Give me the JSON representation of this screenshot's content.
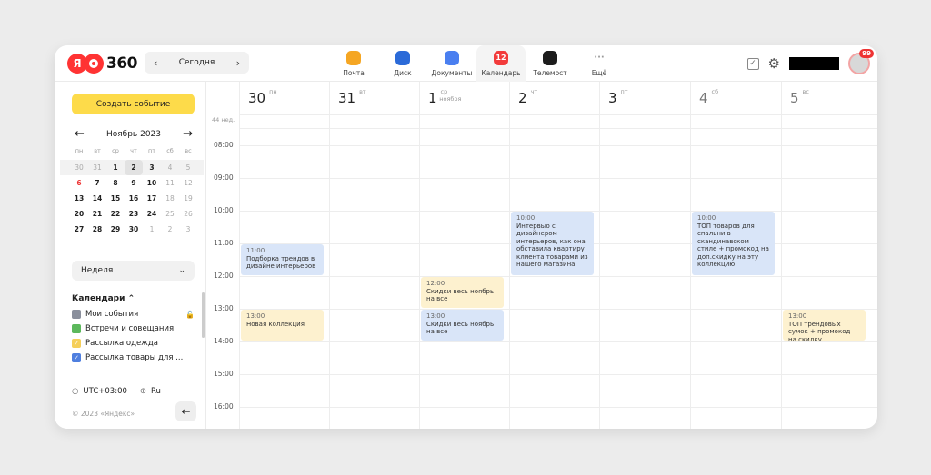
{
  "header": {
    "logo_ya": "Я",
    "logo_num": "360",
    "today_label": "Сегодня",
    "prev_icon": "chevron-left-icon",
    "next_icon": "chevron-right-icon"
  },
  "apps": [
    {
      "label": "Почта",
      "color": "#f5a623",
      "icon": "mail-icon"
    },
    {
      "label": "Диск",
      "color": "#2b6ad8",
      "icon": "disk-icon"
    },
    {
      "label": "Документы",
      "color": "#4a7ff0",
      "icon": "documents-icon"
    },
    {
      "label": "Календарь",
      "color": "#f23b3b",
      "icon": "calendar-icon",
      "glyph": "12"
    },
    {
      "label": "Телемост",
      "color": "#1c1c1c",
      "icon": "telemost-icon"
    },
    {
      "label": "Ещё",
      "color": "",
      "icon": "more-icon",
      "glyph": "···"
    }
  ],
  "user": {
    "notification_count": "99"
  },
  "sidebar": {
    "create_label": "Создать событие",
    "month_label": "Ноябрь 2023",
    "dow": [
      "пн",
      "вт",
      "ср",
      "чт",
      "пт",
      "сб",
      "вс"
    ],
    "weeks": [
      [
        "30",
        "31",
        "1",
        "2",
        "3",
        "4",
        "5"
      ],
      [
        "6",
        "7",
        "8",
        "9",
        "10",
        "11",
        "12"
      ],
      [
        "13",
        "14",
        "15",
        "16",
        "17",
        "18",
        "19"
      ],
      [
        "20",
        "21",
        "22",
        "23",
        "24",
        "25",
        "26"
      ],
      [
        "27",
        "28",
        "29",
        "30",
        "1",
        "2",
        "3"
      ]
    ],
    "view_label": "Неделя",
    "calendars_label": "Календари",
    "calendars": [
      {
        "label": "Мои события",
        "color": "#8a8f9c",
        "checked": false
      },
      {
        "label": "Встречи и совещания",
        "color": "#5cb85c",
        "checked": false
      },
      {
        "label": "Рассылка одежда",
        "color": "#f5cf5a",
        "checked": true
      },
      {
        "label": "Рассылка товары для ...",
        "color": "#4f7fdf",
        "checked": true
      }
    ],
    "timezone": "UTC+03:00",
    "language": "Ru",
    "copyright": "© 2023 «Яндекс»"
  },
  "week": {
    "week_label": "44 нед.",
    "days": [
      {
        "num": "30",
        "dow": "пн",
        "extra": ""
      },
      {
        "num": "31",
        "dow": "вт",
        "extra": ""
      },
      {
        "num": "1",
        "dow": "ср",
        "extra": "ноября"
      },
      {
        "num": "2",
        "dow": "чт",
        "extra": ""
      },
      {
        "num": "3",
        "dow": "пт",
        "extra": ""
      },
      {
        "num": "4",
        "dow": "сб",
        "extra": ""
      },
      {
        "num": "5",
        "dow": "вс",
        "extra": ""
      }
    ],
    "hours": [
      "08:00",
      "09:00",
      "10:00",
      "11:00",
      "12:00",
      "13:00",
      "14:00",
      "15:00",
      "16:00"
    ]
  },
  "events": [
    {
      "day": 0,
      "start": "11:00",
      "end": "12:00",
      "time": "11:00",
      "title": "Подборка трендов в дизайне интерьеров",
      "color": "blue"
    },
    {
      "day": 0,
      "start": "13:00",
      "end": "14:00",
      "time": "13:00",
      "title": "Новая коллекция",
      "color": "yellow"
    },
    {
      "day": 2,
      "start": "12:00",
      "end": "13:00",
      "time": "12:00",
      "title": "Скидки весь ноябрь на все",
      "color": "yellow"
    },
    {
      "day": 2,
      "start": "13:00",
      "end": "14:00",
      "time": "13:00",
      "title": "Скидки весь ноябрь на все",
      "color": "blue"
    },
    {
      "day": 3,
      "start": "10:00",
      "end": "12:00",
      "time": "10:00",
      "title": "Интервью с дизайнером интерьеров, как она обставила квартиру клиента товарами из нашего магазина",
      "color": "blue"
    },
    {
      "day": 5,
      "start": "10:00",
      "end": "12:00",
      "time": "10:00",
      "title": "ТОП товаров для спальни в скандинавском стиле + промокод на доп.скидку на эту коллекцию",
      "color": "blue"
    },
    {
      "day": 6,
      "start": "13:00",
      "end": "14:00",
      "time": "13:00",
      "title": "ТОП трендовых сумок + промокод на скидку",
      "color": "yellow"
    }
  ]
}
